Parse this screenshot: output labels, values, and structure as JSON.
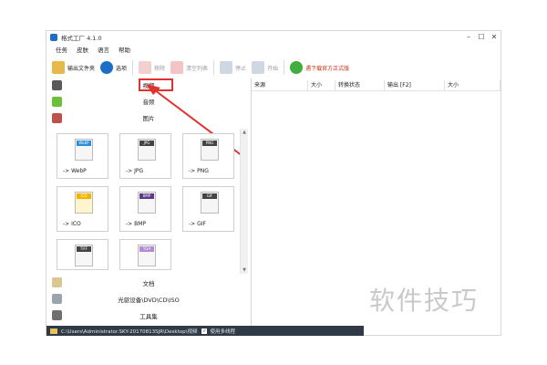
{
  "window": {
    "title": "格式工厂 4.1.0",
    "controls": {
      "minimize": "–",
      "maximize": "☐",
      "close": "✕"
    }
  },
  "menu": [
    "任务",
    "皮肤",
    "语言",
    "帮助"
  ],
  "toolbar": {
    "output_folder": "输出文件夹",
    "options": "选项",
    "remove": "移除",
    "clear_list": "清空列表",
    "stop": "停止",
    "start": "开始",
    "download": "遇下载官方正式版"
  },
  "categories": {
    "video": "视频",
    "audio": "音频",
    "image": "图片",
    "document": "文档",
    "disc": "光驱设备\\DVD\\CD\\ISO",
    "tools": "工具集"
  },
  "formats": [
    {
      "tag": "WebP",
      "label": "-> WebP",
      "color": "#2a8fd6"
    },
    {
      "tag": "JPG",
      "label": "-> JPG",
      "color": "#333333"
    },
    {
      "tag": "PNG",
      "label": "-> PNG",
      "color": "#333333"
    },
    {
      "tag": "ICO",
      "label": "-> ICO",
      "color": "#f0b400"
    },
    {
      "tag": "BMP",
      "label": "-> BMP",
      "color": "#5b3a8c"
    },
    {
      "tag": "GIF",
      "label": "-> GIF",
      "color": "#333333"
    },
    {
      "tag": "TIFF",
      "label": "",
      "color": "#333333"
    },
    {
      "tag": "TGA",
      "label": "",
      "color": "#b48ad2"
    }
  ],
  "columns": [
    "来源",
    "大小",
    "转换状态",
    "输出 [F2]",
    "大小"
  ],
  "status": {
    "path": "C:\\Users\\Administrator.SKY-20170813SJR\\Desktop\\视频",
    "multithread_label": "使用多线程",
    "multithread_checked": true
  },
  "watermark": "软件技巧",
  "colors": {
    "highlight": "#e0322f",
    "statusbar": "#2f3a46",
    "accent": "#1e6ec8"
  }
}
